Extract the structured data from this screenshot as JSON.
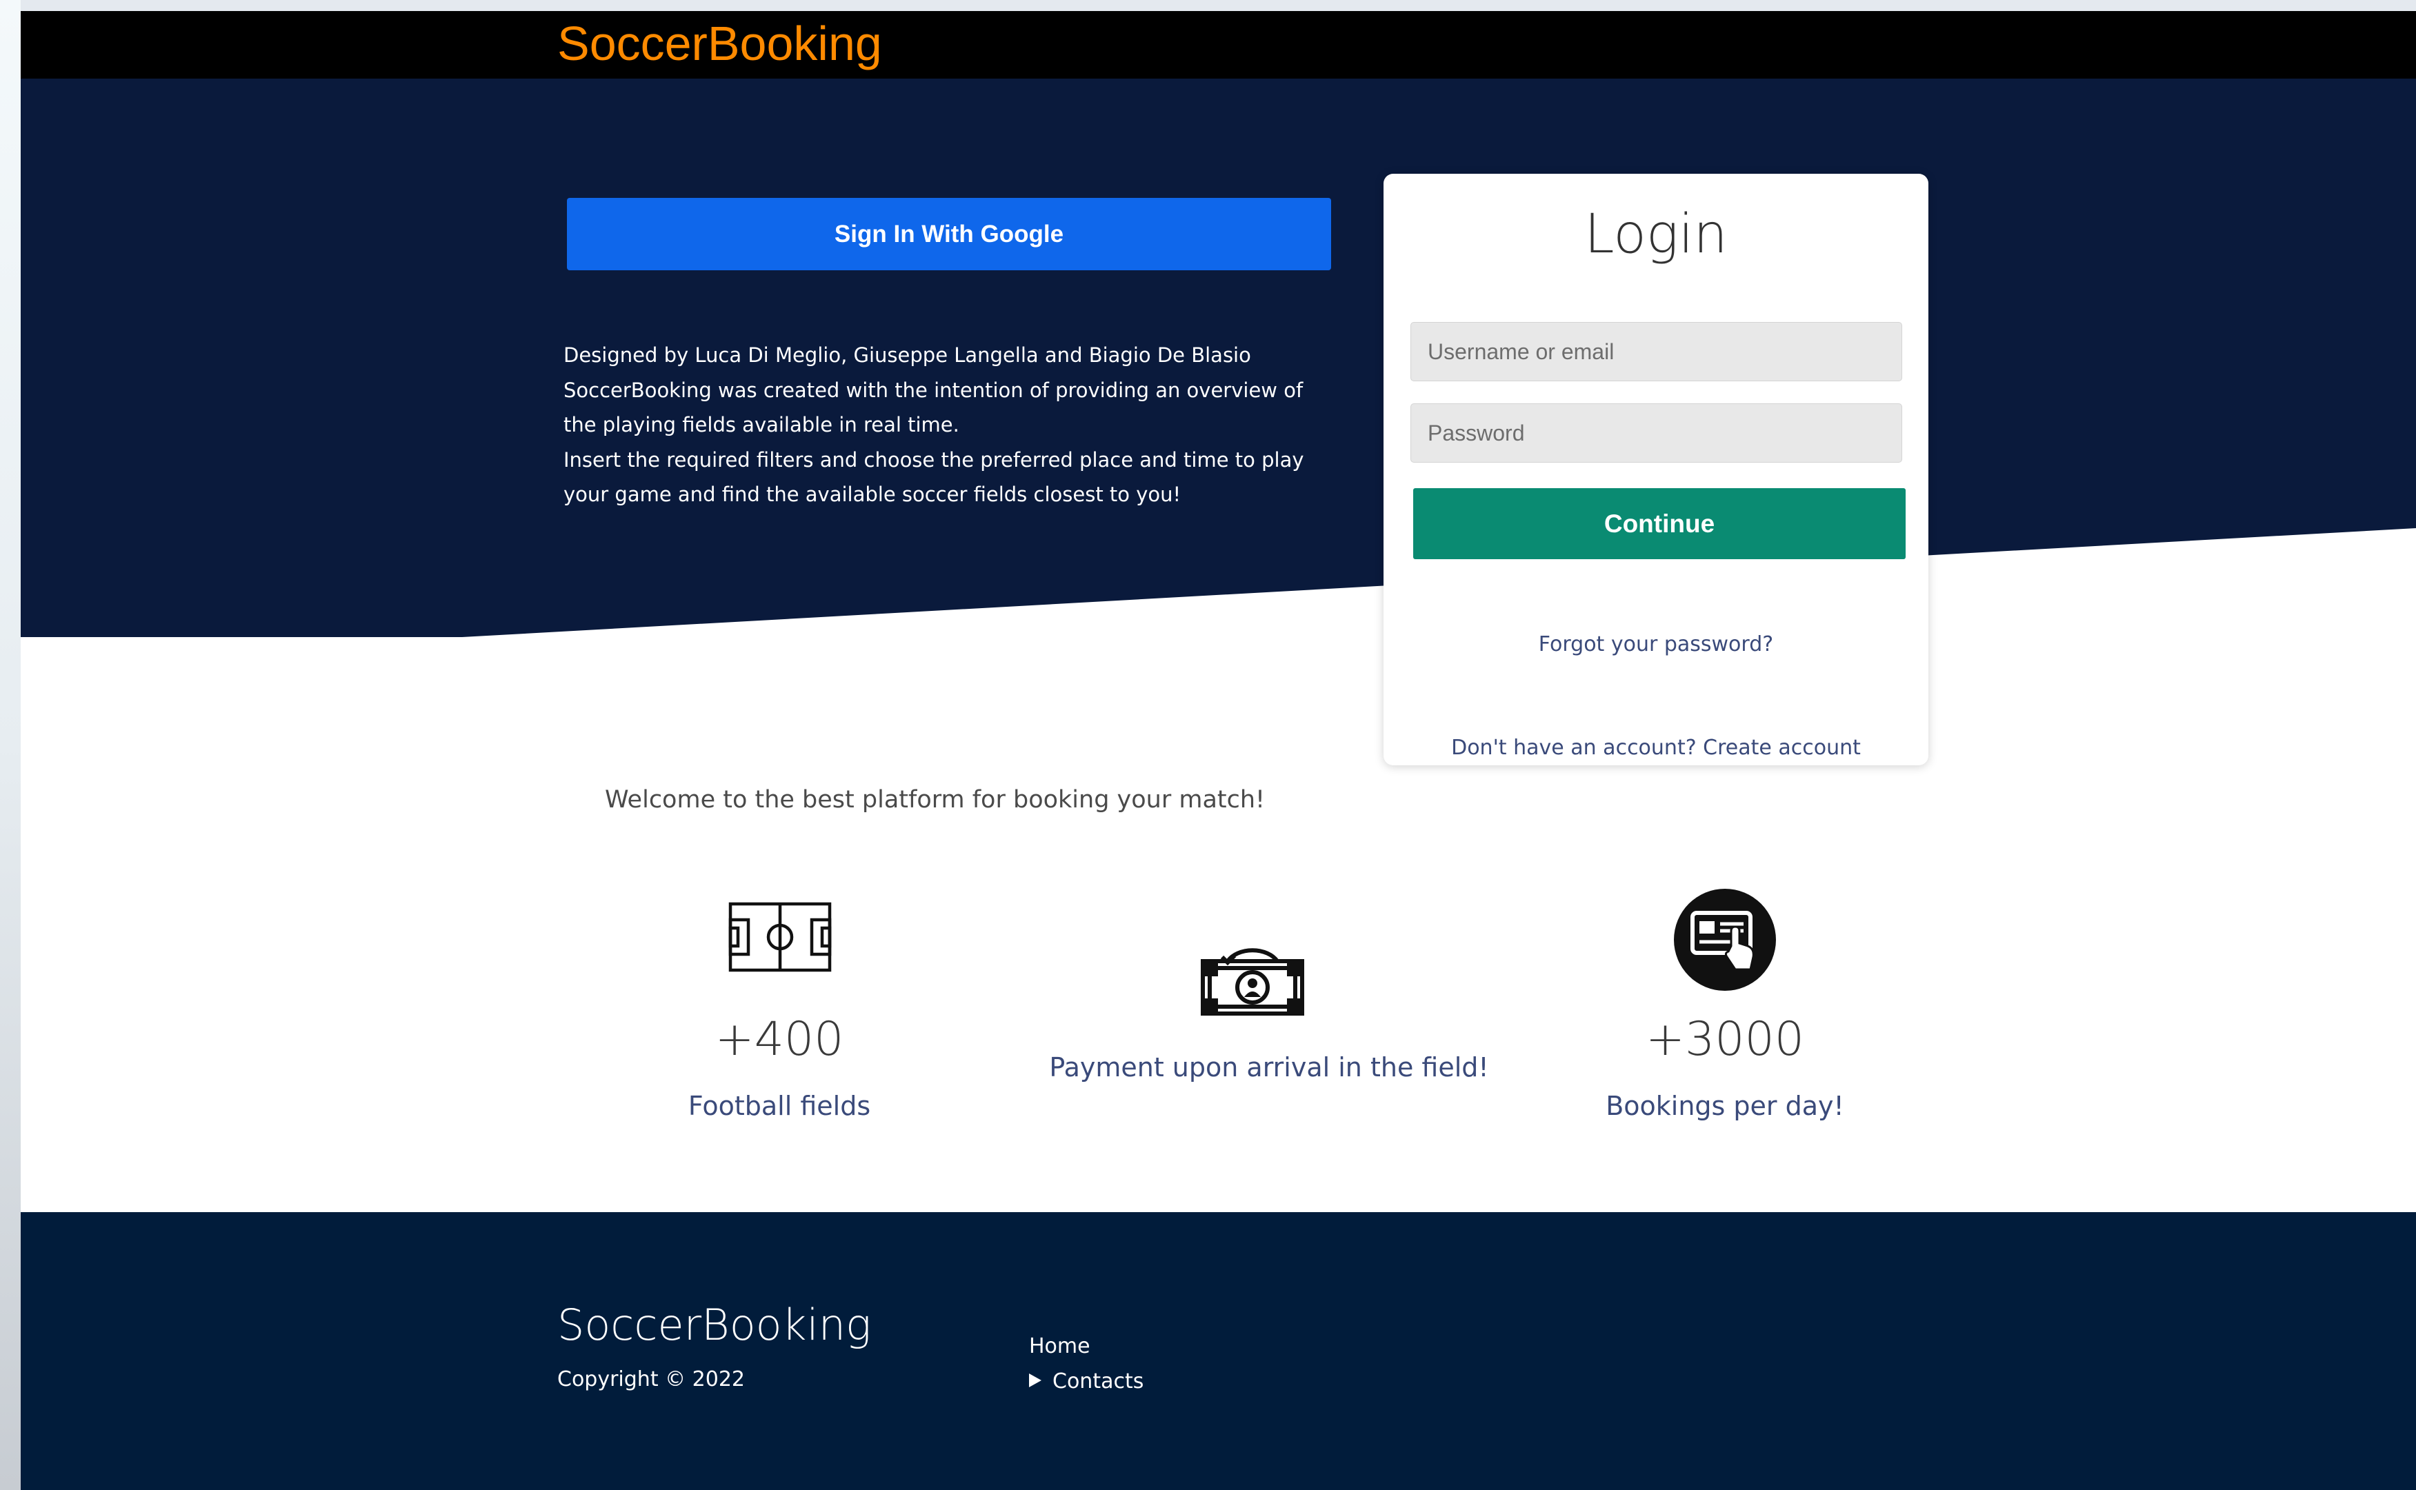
{
  "header": {
    "brand": "SoccerBooking"
  },
  "hero": {
    "google_button": "Sign In With Google",
    "about_lines": [
      "Designed by Luca Di Meglio, Giuseppe Langella and Biagio De Blasio",
      "SoccerBooking was created with the intention of providing an overview of the playing fields available in real time.",
      "Insert the required filters and choose the preferred place and time to play your game and find the available soccer fields closest to you!"
    ]
  },
  "login": {
    "title": "Login",
    "username_placeholder": "Username or email",
    "password_placeholder": "Password",
    "continue_label": "Continue",
    "forgot_link": "Forgot your password?",
    "create_account_link": "Don't have an account? Create account"
  },
  "main": {
    "welcome": "Welcome to the best platform for booking your match!",
    "stats": [
      {
        "icon": "football-field-icon",
        "value": "+400",
        "label": "Football fields"
      },
      {
        "icon": "money-bill-icon",
        "label": "Payment upon arrival in the field!"
      },
      {
        "icon": "booking-card-tap-icon",
        "value": "+3000",
        "label": "Bookings per day!"
      }
    ]
  },
  "footer": {
    "brand": "SoccerBooking",
    "copyright": "Copyright © 2022",
    "links": [
      "Home",
      "Contacts"
    ]
  },
  "colors": {
    "brand_orange": "#ff8a00",
    "navy": "#0a1a3c",
    "footer_navy": "#011c3b",
    "google_blue": "#0f67eb",
    "continue_green": "#0a8b72",
    "link_blue": "#3a4a7a"
  }
}
